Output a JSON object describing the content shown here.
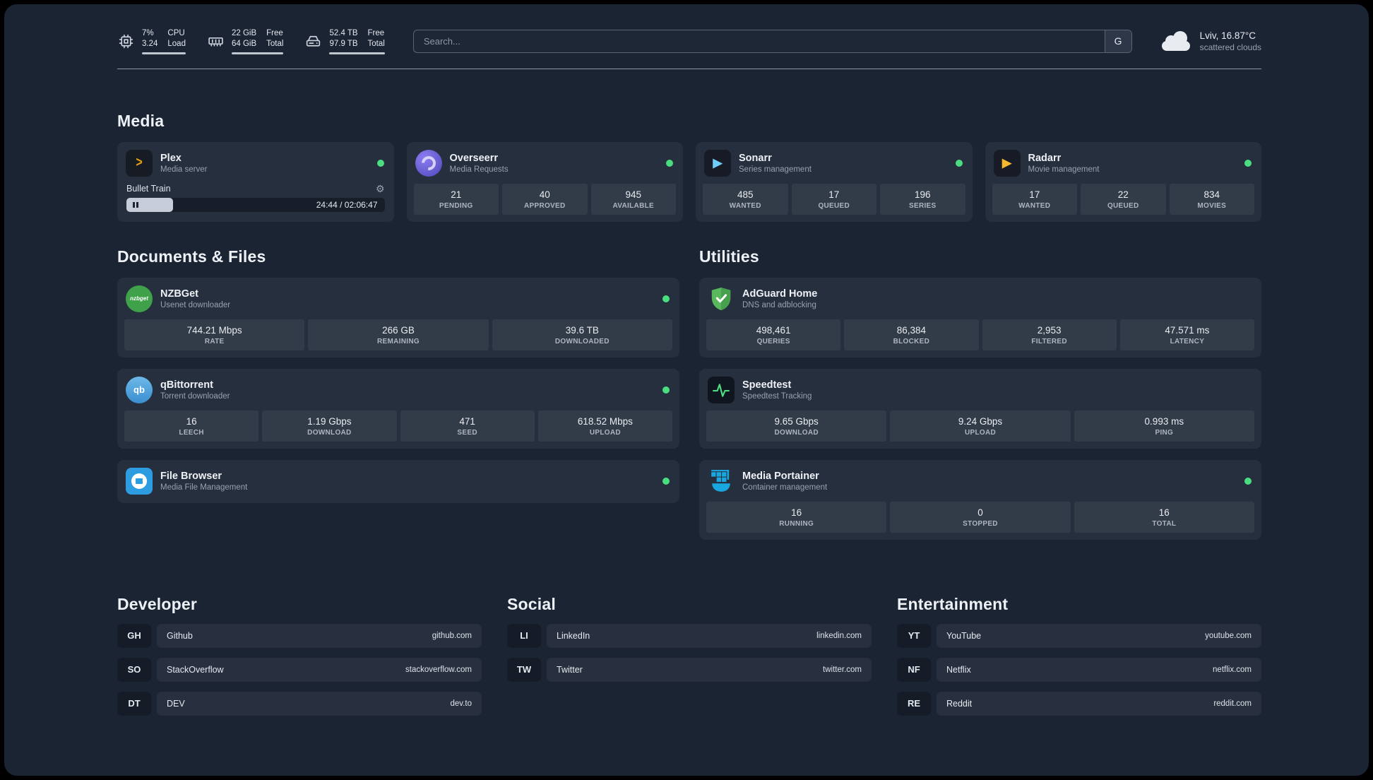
{
  "colors": {
    "status_online": "#4ade80",
    "plex_accent": "#e5a00d",
    "sonarr_accent": "#6fcdf7",
    "radarr_accent": "#f5b82e",
    "adguard_green": "#59b85c",
    "portainer_blue": "#19a7e0"
  },
  "topbar": {
    "resources": [
      {
        "icon": "cpu-icon",
        "col1": {
          "top": "7%",
          "bottom": "3.24"
        },
        "col2": {
          "top": "CPU",
          "bottom": "Load"
        }
      },
      {
        "icon": "memory-icon",
        "col1": {
          "top": "22 GiB",
          "bottom": "64 GiB"
        },
        "col2": {
          "top": "Free",
          "bottom": "Total"
        }
      },
      {
        "icon": "disk-icon",
        "col1": {
          "top": "52.4 TB",
          "bottom": "97.9 TB"
        },
        "col2": {
          "top": "Free",
          "bottom": "Total"
        }
      }
    ],
    "search": {
      "placeholder": "Search...",
      "provider_button": "G"
    },
    "weather": {
      "location": "Lviv, 16.87°C",
      "condition": "scattered clouds"
    }
  },
  "media": {
    "title": "Media",
    "cards": [
      {
        "name": "Plex",
        "desc": "Media server",
        "player": {
          "track": "Bullet Train",
          "time": "24:44 / 02:06:47"
        }
      },
      {
        "name": "Overseerr",
        "desc": "Media Requests",
        "stats": [
          {
            "value": "21",
            "label": "PENDING"
          },
          {
            "value": "40",
            "label": "APPROVED"
          },
          {
            "value": "945",
            "label": "AVAILABLE"
          }
        ]
      },
      {
        "name": "Sonarr",
        "desc": "Series management",
        "stats": [
          {
            "value": "485",
            "label": "WANTED"
          },
          {
            "value": "17",
            "label": "QUEUED"
          },
          {
            "value": "196",
            "label": "SERIES"
          }
        ]
      },
      {
        "name": "Radarr",
        "desc": "Movie management",
        "stats": [
          {
            "value": "17",
            "label": "WANTED"
          },
          {
            "value": "22",
            "label": "QUEUED"
          },
          {
            "value": "834",
            "label": "MOVIES"
          }
        ]
      }
    ]
  },
  "documents": {
    "title": "Documents & Files",
    "cards": [
      {
        "name": "NZBGet",
        "desc": "Usenet downloader",
        "stats": [
          {
            "value": "744.21 Mbps",
            "label": "RATE"
          },
          {
            "value": "266 GB",
            "label": "REMAINING"
          },
          {
            "value": "39.6 TB",
            "label": "DOWNLOADED"
          }
        ]
      },
      {
        "name": "qBittorrent",
        "desc": "Torrent downloader",
        "stats": [
          {
            "value": "16",
            "label": "LEECH"
          },
          {
            "value": "1.19 Gbps",
            "label": "DOWNLOAD"
          },
          {
            "value": "471",
            "label": "SEED"
          },
          {
            "value": "618.52 Mbps",
            "label": "UPLOAD"
          }
        ]
      },
      {
        "name": "File Browser",
        "desc": "Media File Management"
      }
    ]
  },
  "utilities": {
    "title": "Utilities",
    "cards": [
      {
        "name": "AdGuard Home",
        "desc": "DNS and adblocking",
        "stats": [
          {
            "value": "498,461",
            "label": "QUERIES"
          },
          {
            "value": "86,384",
            "label": "BLOCKED"
          },
          {
            "value": "2,953",
            "label": "FILTERED"
          },
          {
            "value": "47.571 ms",
            "label": "LATENCY"
          }
        ]
      },
      {
        "name": "Speedtest",
        "desc": "Speedtest Tracking",
        "stats": [
          {
            "value": "9.65 Gbps",
            "label": "DOWNLOAD"
          },
          {
            "value": "9.24 Gbps",
            "label": "UPLOAD"
          },
          {
            "value": "0.993 ms",
            "label": "PING"
          }
        ]
      },
      {
        "name": "Media Portainer",
        "desc": "Container management",
        "stats": [
          {
            "value": "16",
            "label": "RUNNING"
          },
          {
            "value": "0",
            "label": "STOPPED"
          },
          {
            "value": "16",
            "label": "TOTAL"
          }
        ]
      }
    ]
  },
  "bookmarks": [
    {
      "title": "Developer",
      "items": [
        {
          "abbr": "GH",
          "name": "Github",
          "domain": "github.com"
        },
        {
          "abbr": "SO",
          "name": "StackOverflow",
          "domain": "stackoverflow.com"
        },
        {
          "abbr": "DT",
          "name": "DEV",
          "domain": "dev.to"
        }
      ]
    },
    {
      "title": "Social",
      "items": [
        {
          "abbr": "LI",
          "name": "LinkedIn",
          "domain": "linkedin.com"
        },
        {
          "abbr": "TW",
          "name": "Twitter",
          "domain": "twitter.com"
        }
      ]
    },
    {
      "title": "Entertainment",
      "items": [
        {
          "abbr": "YT",
          "name": "YouTube",
          "domain": "youtube.com"
        },
        {
          "abbr": "NF",
          "name": "Netflix",
          "domain": "netflix.com"
        },
        {
          "abbr": "RE",
          "name": "Reddit",
          "domain": "reddit.com"
        }
      ]
    }
  ],
  "icons": {
    "nzbget_text": "nzbget",
    "qbittorrent_text": "qb",
    "play_glyph": "▶"
  }
}
